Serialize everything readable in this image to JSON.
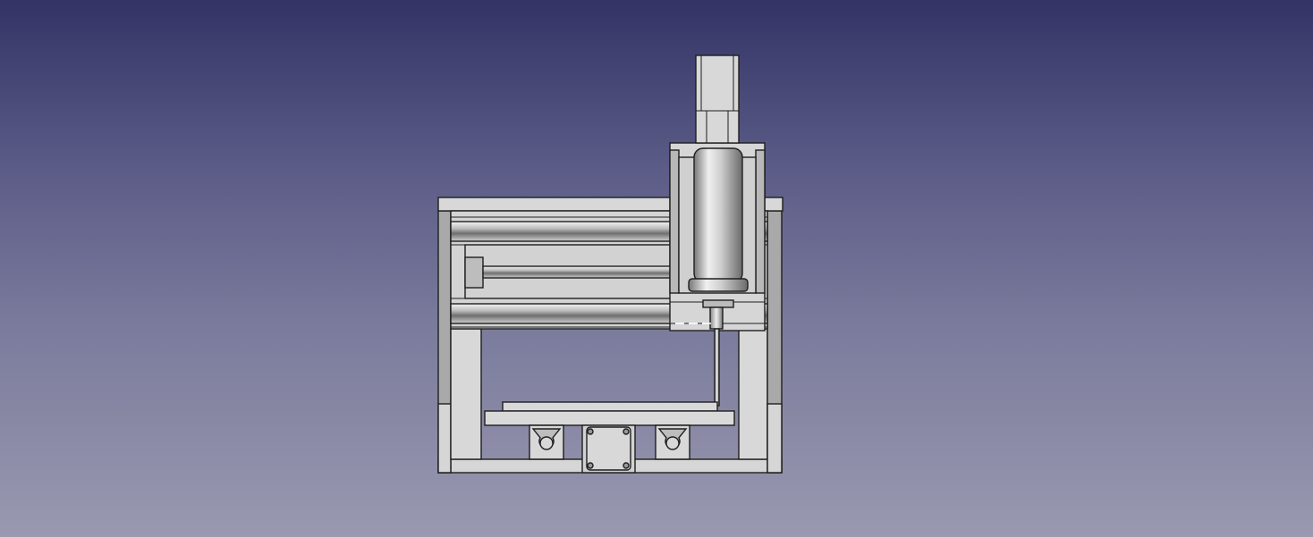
{
  "view": {
    "type": "3d-viewport",
    "background": {
      "top_color": "#333366",
      "bottom_color": "#9999b0"
    },
    "model": {
      "description_icon": "cnc-router-front-view",
      "face_color": "#d4d4d4",
      "edge_color": "#1e1e1e",
      "shadow_color": "#a8a8a8"
    }
  }
}
